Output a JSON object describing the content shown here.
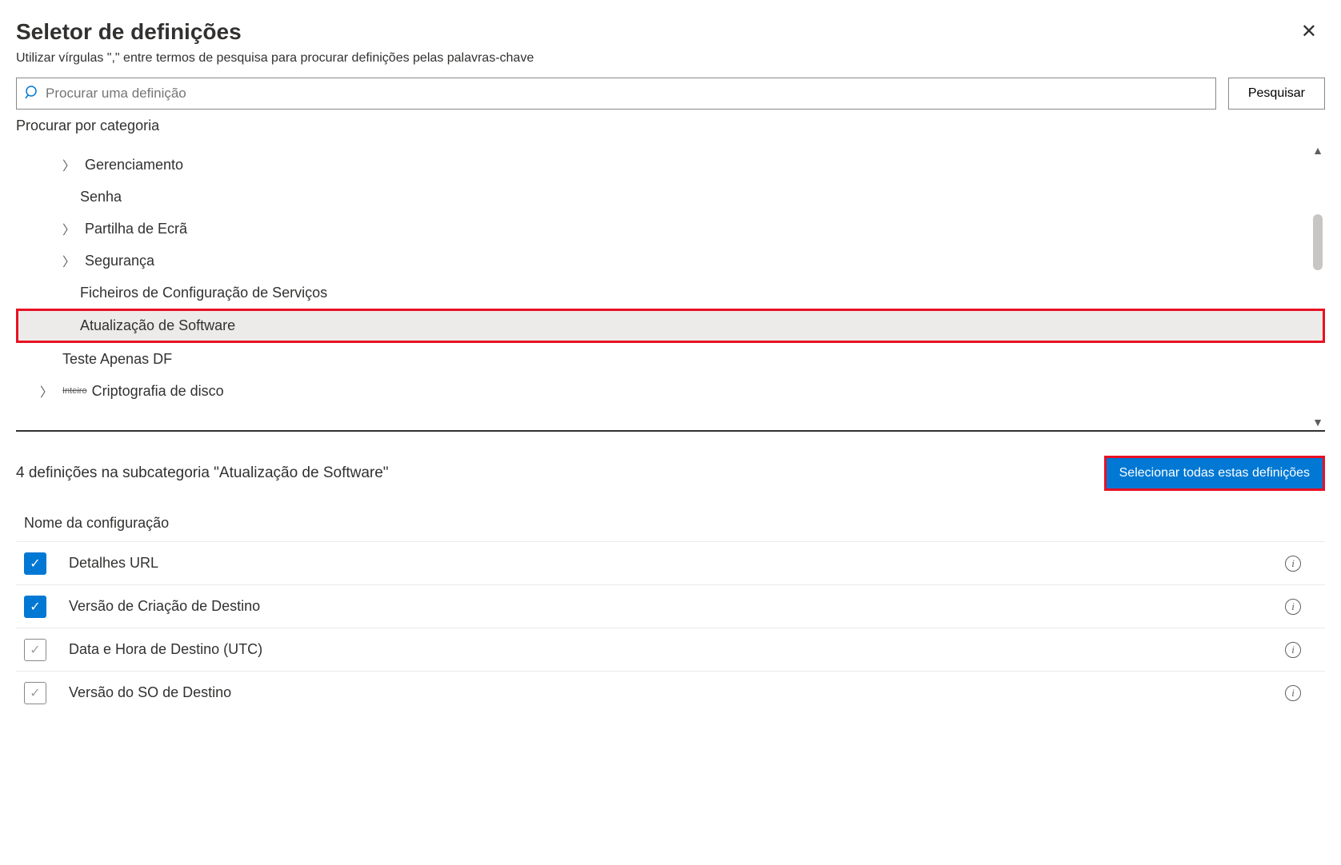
{
  "header": {
    "title": "Seletor de definições",
    "subtitle": "Utilizar vírgulas \",\" entre termos de pesquisa para procurar definições pelas palavras-chave"
  },
  "search": {
    "placeholder": "Procurar uma definição",
    "button": "Pesquisar"
  },
  "browse_label": "Procurar por categoria",
  "tree": {
    "items": [
      {
        "label": "Gerenciamento",
        "chevron": true,
        "level": 2
      },
      {
        "label": "Senha",
        "chevron": false,
        "level": 2
      },
      {
        "label": "Partilha de Ecrã",
        "chevron": true,
        "level": 2
      },
      {
        "label": "Segurança",
        "chevron": true,
        "level": 2
      },
      {
        "label": "Ficheiros de Configuração de Serviços",
        "chevron": false,
        "level": 2
      },
      {
        "label": "Atualização de Software",
        "chevron": false,
        "level": 2,
        "selected": true
      },
      {
        "label": "Teste Apenas DF",
        "chevron": false,
        "level": 1
      },
      {
        "label": "Criptografia de disco",
        "chevron": true,
        "level": 1,
        "prefix": "Inteiro"
      }
    ]
  },
  "results": {
    "count_label": "4 definições na subcategoria \"Atualização de Software\"",
    "select_all": "Selecionar todas estas definições",
    "column_header": "Nome da configuração",
    "settings": [
      {
        "label": "Detalhes URL",
        "checked": true
      },
      {
        "label": "Versão de Criação de Destino",
        "checked": true
      },
      {
        "label": "Data e Hora de Destino (UTC)",
        "checked": false
      },
      {
        "label": "Versão do SO de Destino",
        "checked": false
      }
    ]
  }
}
